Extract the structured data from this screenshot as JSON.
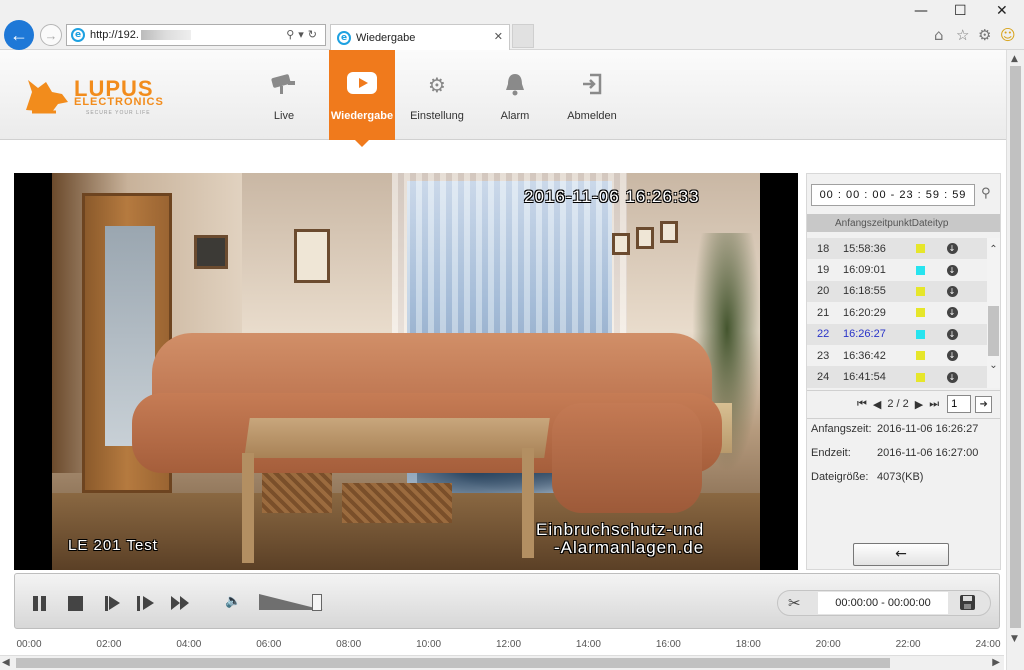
{
  "browser": {
    "url": "http://192.",
    "tab_title": "Wiedergabe",
    "tab_close": "✕",
    "icons": [
      "back-arrow-icon",
      "forward-arrow-icon",
      "search-icon",
      "refresh-icon",
      "home-icon",
      "star-icon",
      "gear-icon",
      "smiley-icon"
    ],
    "window_controls": {
      "minimize": "—",
      "maximize": "☐",
      "close": "✕"
    }
  },
  "logo": {
    "main": "LUPUS",
    "sub": "ELECTRONICS",
    "tagline": "SECURE YOUR LIFE"
  },
  "nav": {
    "items": [
      {
        "label": "Live",
        "icon": "camera-icon"
      },
      {
        "label": "Wiedergabe",
        "icon": "play-icon",
        "active": true
      },
      {
        "label": "Einstellung",
        "icon": "gear-icon"
      },
      {
        "label": "Alarm",
        "icon": "bell-icon"
      },
      {
        "label": "Abmelden",
        "icon": "logout-icon"
      }
    ]
  },
  "video": {
    "timestamp": "2016-11-06 16:26:33",
    "camera_name": "LE 201 Test",
    "watermark_line1": "Einbruchschutz-und",
    "watermark_line2": "-Alarmanlagen.de"
  },
  "panel": {
    "time_range": "00 : 00 : 00 - 23 : 59 : 59",
    "header_start": "Anfangszeitpunkt",
    "header_type": "Dateityp",
    "files": [
      {
        "no": "18",
        "time": "15:58:36",
        "color": "#e6e62a"
      },
      {
        "no": "19",
        "time": "16:09:01",
        "color": "#27e4ef"
      },
      {
        "no": "20",
        "time": "16:18:55",
        "color": "#e6e62a"
      },
      {
        "no": "21",
        "time": "16:20:29",
        "color": "#e6e62a"
      },
      {
        "no": "22",
        "time": "16:26:27",
        "color": "#27e4ef",
        "selected": true
      },
      {
        "no": "23",
        "time": "16:36:42",
        "color": "#e6e62a"
      },
      {
        "no": "24",
        "time": "16:41:54",
        "color": "#e6e62a"
      }
    ],
    "pager": {
      "page_info": "2 / 2",
      "page_input": "1"
    },
    "info": {
      "start_label": "Anfangszeit:",
      "start_value": "2016-11-06 16:26:27",
      "end_label": "Endzeit:",
      "end_value": "2016-11-06 16:27:00",
      "size_label": "Dateigröße:",
      "size_value": "4073(KB)"
    },
    "back_button": "←"
  },
  "controls": {
    "volume_level": 0.9,
    "clip_range": "00:00:00 - 00:00:00"
  },
  "timeline": {
    "ticks": [
      "00:00",
      "02:00",
      "04:00",
      "06:00",
      "08:00",
      "10:00",
      "12:00",
      "14:00",
      "16:00",
      "18:00",
      "20:00",
      "22:00",
      "24:00"
    ]
  },
  "colors": {
    "accent": "#f07a1c",
    "selected_text": "#2a34c8",
    "browser_blue": "#1e78d7"
  }
}
